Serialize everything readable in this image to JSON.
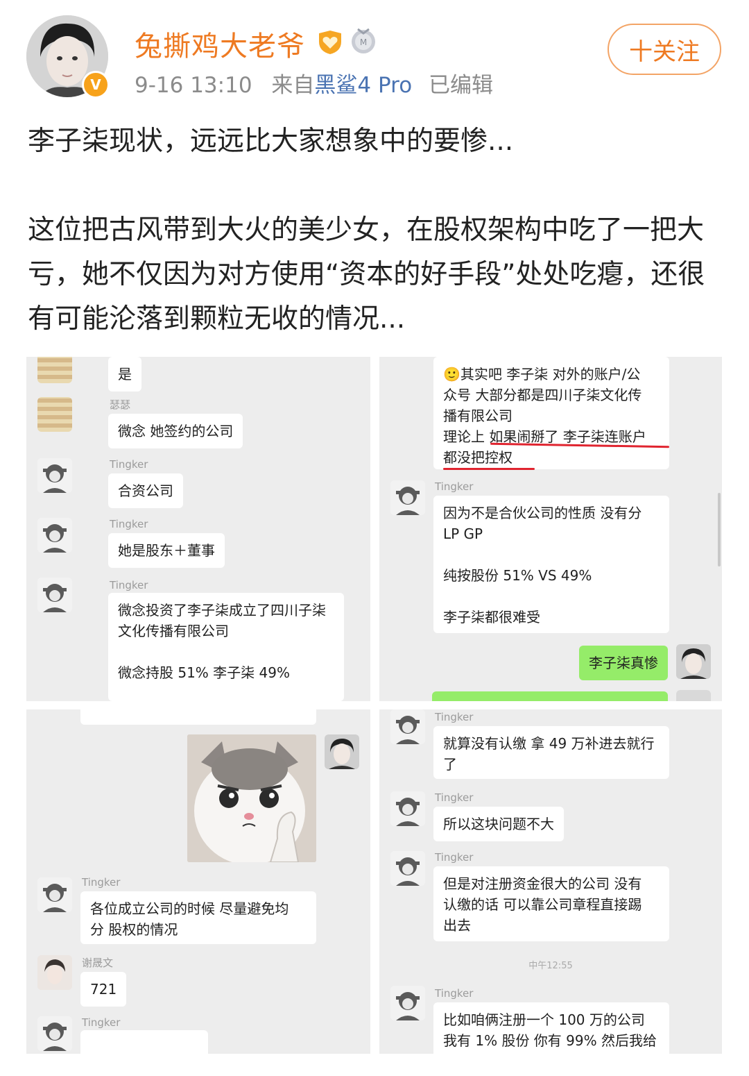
{
  "header": {
    "username": "兔撕鸡大老爷",
    "rank_badge_icon": "heart-rank-badge",
    "medal_icon": "medal-badge",
    "verified_icon": "verified-v-badge",
    "timestamp": "9-16 13:10",
    "from_label": "来自",
    "device": "黑鲨4 Pro",
    "edited_label": "已编辑",
    "follow_button": "十关注"
  },
  "post": {
    "paragraph_1": "李子柒现状，远远比大家想象中的要惨...",
    "paragraph_2": "这位把古风带到大火的美少女，在股权架构中吃了一把大亏，她不仅因为对方使用“资本的好手段”处处吃瘪，还很有可能沦落到颗粒无收的情况..."
  },
  "chat_a": {
    "msg1": "是",
    "sender2": "瑟瑟",
    "msg2": "微念 她签约的公司",
    "sender3": "Tingker",
    "msg3": "合资公司",
    "sender4": "Tingker",
    "msg4": "她是股东＋董事",
    "sender5": "Tingker",
    "msg5_line1": "微念投资了李子柒成立了四川子柒",
    "msg5_line2": "文化传播有限公司",
    "msg5_line3": "微念持股 51% 李子柒 49%"
  },
  "chat_b": {
    "msg1_line1": "🙂其实吧 李子柒 对外的账户/公",
    "msg1_line2": "众号 大部分都是四川子柒文化传",
    "msg1_line3": "播有限公司",
    "msg1_line4": "理论上 如果闹掰了 李子柒连账户",
    "msg1_line5": "都没把控权",
    "sender2": "Tingker",
    "msg2_line1": "因为不是合伙公司的性质 没有分",
    "msg2_line2": "LP GP",
    "msg2_line3": "纯按股份 51% VS 49%",
    "msg2_line4": "李子柒都很难受",
    "msg3": "李子柒真惨"
  },
  "chat_c": {
    "sender1": "Tingker",
    "msg1_line1": "各位成立公司的时候  尽量避免均",
    "msg1_line2": "分 股权的情况",
    "sender2": "谢晟文",
    "msg2": "721",
    "sender3": "Tingker"
  },
  "chat_d": {
    "sender1": "Tingker",
    "msg1_line1": "就算没有认缴 拿 49 万补进去就行",
    "msg1_line2": "了",
    "sender2": "Tingker",
    "msg2": "所以这块问题不大",
    "sender3": "Tingker",
    "msg3_line1": "但是对注册资金很大的公司 没有",
    "msg3_line2": "认缴的话 可以靠公司章程直接踢",
    "msg3_line3": "出去",
    "timestamp": "中午12:55",
    "sender4": "Tingker",
    "msg4_line1": "比如咱俩注册一个 100 万的公司",
    "msg4_line2": "我有 1% 股份 你有 99%    然后我给"
  },
  "colors": {
    "username": "#ee7a22",
    "device_link": "#4a73b2",
    "chat_bg": "#ededed",
    "bubble_self": "#95ec69",
    "annotation_underline": "#e0242f"
  }
}
